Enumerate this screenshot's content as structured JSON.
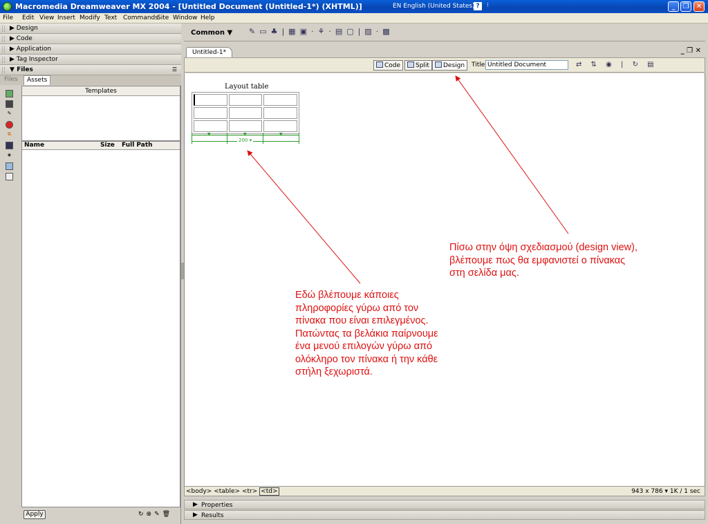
{
  "window": {
    "title": "Macromedia Dreamweaver MX 2004 - [Untitled Document (Untitled-1*) (XHTML)]",
    "language": "EN English (United States)",
    "help": "?"
  },
  "menu": [
    "File",
    "Edit",
    "View",
    "Insert",
    "Modify",
    "Text",
    "Commands",
    "Site",
    "Window",
    "Help"
  ],
  "panels": {
    "design": "Design",
    "code": "Code",
    "application": "Application",
    "tag_inspector": "Tag Inspector",
    "files": "Files",
    "files_tab": "Files",
    "assets_tab": "Assets",
    "templates_header": "Templates",
    "columns": {
      "name": "Name",
      "size": "Size",
      "path": "Full Path"
    },
    "apply": "Apply"
  },
  "insert_bar": {
    "category": "Common"
  },
  "document": {
    "tab": "Untitled-1*",
    "view_code": "Code",
    "view_split": "Split",
    "view_design": "Design",
    "title_label": "Title:",
    "title_value": "Untitled Document"
  },
  "design_view": {
    "table_caption": "Layout table",
    "table_width": "200",
    "rows": 3,
    "cols": 3
  },
  "annotations": {
    "design_view": [
      "Πίσω στην όψη σχεδιασμού (design view),",
      "βλέπουμε πως θα εμφανιστεί ο πίνακας",
      "στη σελίδα μας."
    ],
    "table_info": [
      "Εδώ βλέπουμε κάποιες",
      "πληροφορίες γύρω από τον",
      "πίνακα που είναι επιλεγμένος.",
      "Πατώντας τα βελάκια παίρνουμε",
      "ένα μενού επιλογών γύρω από",
      "ολόκληρο τον πίνακα ή την κάθε",
      "στήλη ξεχωριστά."
    ]
  },
  "status": {
    "tag_body": "<body>",
    "tag_table": "<table>",
    "tag_tr": "<tr>",
    "tag_td": "<td>",
    "size": "943 x 786 ▾ 1K / 1 sec"
  },
  "bottom_panels": {
    "properties": "Properties",
    "results": "Results"
  },
  "colors": {
    "annotation": "#dd1111",
    "title_bar": "#0a5fd8",
    "table_width_guide": "#2c9c2c"
  }
}
